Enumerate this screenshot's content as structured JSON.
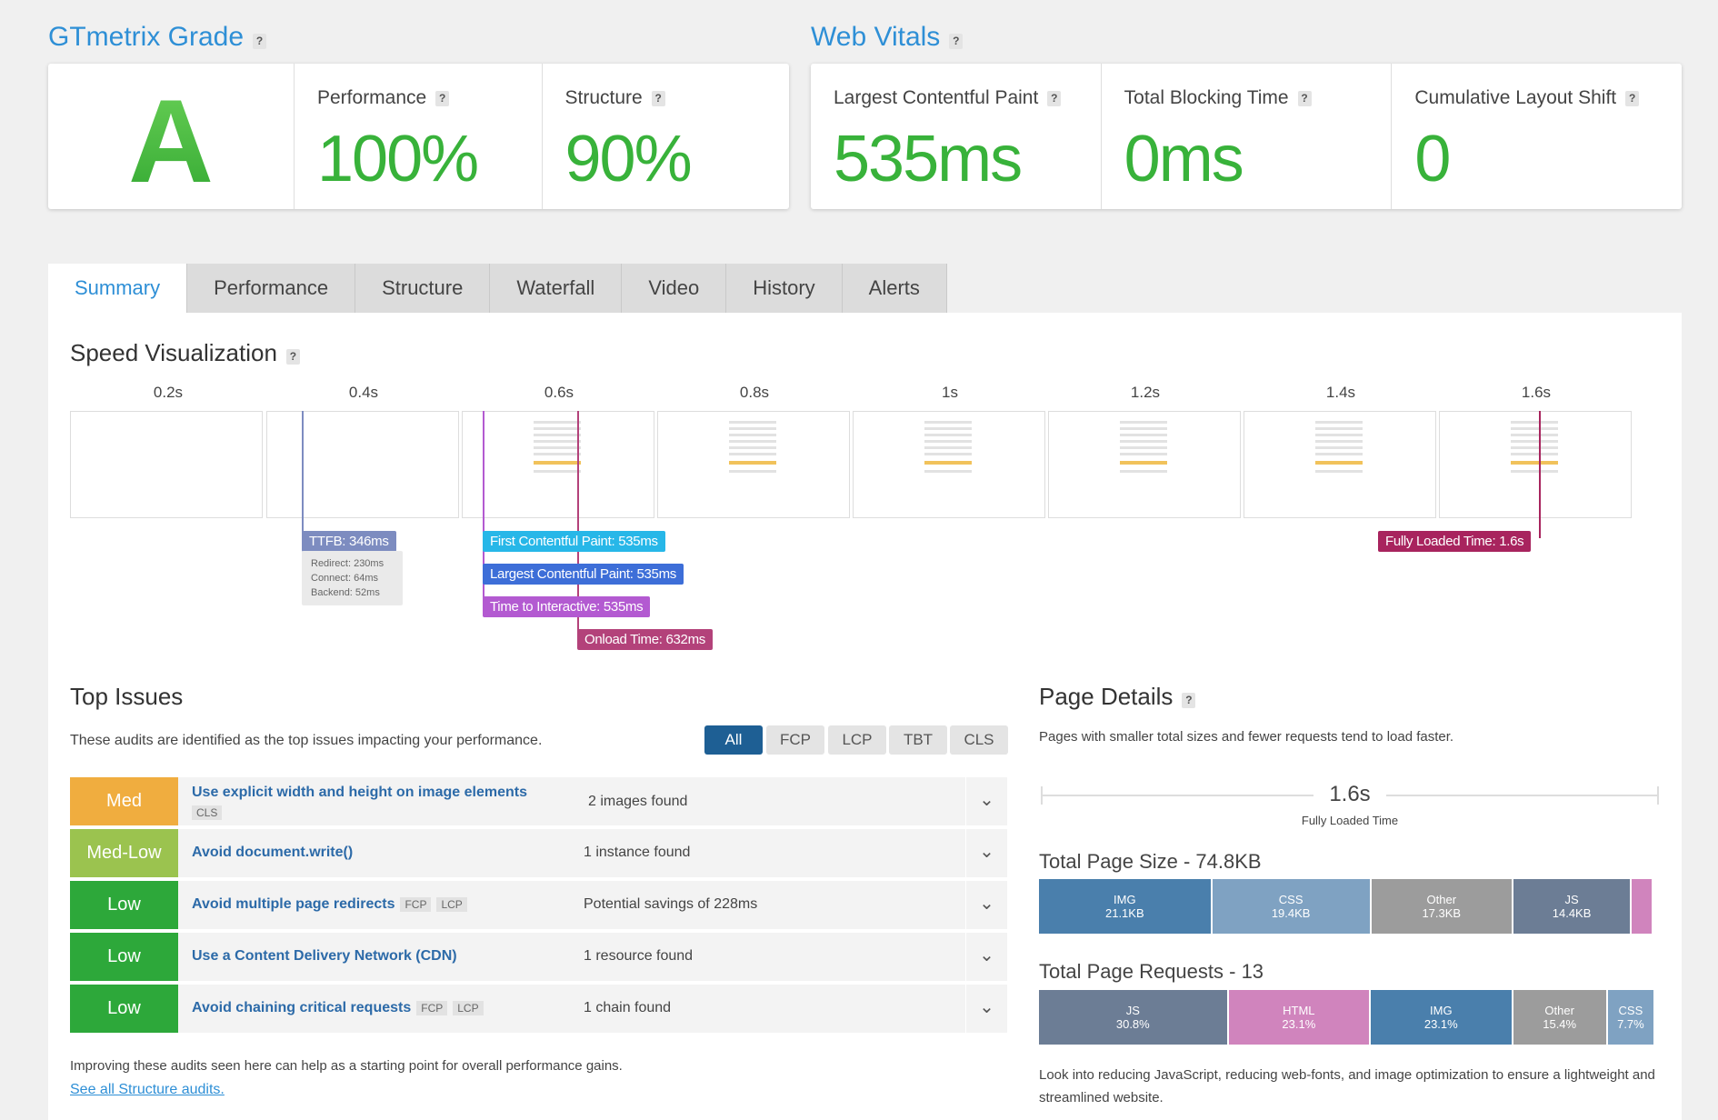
{
  "grade": {
    "title": "GTmetrix Grade",
    "letter": "A",
    "performance_label": "Performance",
    "performance_value": "100%",
    "structure_label": "Structure",
    "structure_value": "90%"
  },
  "vitals": {
    "title": "Web Vitals",
    "lcp_label": "Largest Contentful Paint",
    "lcp_value": "535ms",
    "tbt_label": "Total Blocking Time",
    "tbt_value": "0ms",
    "cls_label": "Cumulative Layout Shift",
    "cls_value": "0"
  },
  "help_glyph": "?",
  "tabs": [
    "Summary",
    "Performance",
    "Structure",
    "Waterfall",
    "Video",
    "History",
    "Alerts"
  ],
  "speed": {
    "title": "Speed Visualization",
    "ticks": [
      "0.2s",
      "0.4s",
      "0.6s",
      "0.8s",
      "1s",
      "1.2s",
      "1.4s",
      "1.6s"
    ],
    "ttfb": "TTFB: 346ms",
    "redirect": "Redirect: 230ms",
    "connect": "Connect: 64ms",
    "backend": "Backend: 52ms",
    "fcp": "First Contentful Paint: 535ms",
    "lcp": "Largest Contentful Paint: 535ms",
    "tti": "Time to Interactive: 535ms",
    "onload": "Onload Time: 632ms",
    "fully": "Fully Loaded Time: 1.6s",
    "colors": {
      "ttfb": "#7d8cc0",
      "fcp": "#27b7e8",
      "lcp": "#3d6ed8",
      "tti": "#b35ad1",
      "onload": "#b3427a",
      "fully": "#a8245e"
    }
  },
  "issues": {
    "title": "Top Issues",
    "desc": "These audits are identified as the top issues impacting your performance.",
    "filters": [
      "All",
      "FCP",
      "LCP",
      "TBT",
      "CLS"
    ],
    "items": [
      {
        "severity": "Med",
        "color": "#f0ad3f",
        "title": "Use explicit width and height on image elements",
        "tags": [
          "CLS"
        ],
        "finding": "2 images found"
      },
      {
        "severity": "Med-Low",
        "color": "#9bc34f",
        "title": "Avoid document.write()",
        "tags": [],
        "finding": "1 instance found"
      },
      {
        "severity": "Low",
        "color": "#2da83a",
        "title": "Avoid multiple page redirects",
        "tags": [
          "FCP",
          "LCP"
        ],
        "finding": "Potential savings of 228ms"
      },
      {
        "severity": "Low",
        "color": "#2da83a",
        "title": "Use a Content Delivery Network (CDN)",
        "tags": [],
        "finding": "1 resource found"
      },
      {
        "severity": "Low",
        "color": "#2da83a",
        "title": "Avoid chaining critical requests",
        "tags": [
          "FCP",
          "LCP"
        ],
        "finding": "1 chain found"
      }
    ],
    "footer": "Improving these audits seen here can help as a starting point for overall performance gains.",
    "link": "See all Structure audits."
  },
  "details": {
    "title": "Page Details",
    "desc": "Pages with smaller total sizes and fewer requests tend to load faster.",
    "fully_value": "1.6s",
    "fully_label": "Fully Loaded Time",
    "size_title": "Total Page Size - 74.8KB",
    "size_segments": [
      {
        "name": "IMG",
        "value": "21.1KB",
        "share": 28.2,
        "color": "#4a7fac"
      },
      {
        "name": "CSS",
        "value": "19.4KB",
        "share": 25.9,
        "color": "#7fa2c2"
      },
      {
        "name": "Other",
        "value": "17.3KB",
        "share": 23.1,
        "color": "#9c9c9c"
      },
      {
        "name": "JS",
        "value": "14.4KB",
        "share": 19.3,
        "color": "#6c7d95"
      },
      {
        "name": "",
        "value": "",
        "share": 3.5,
        "color": "#d084bd"
      }
    ],
    "req_title": "Total Page Requests - 13",
    "req_segments": [
      {
        "name": "JS",
        "value": "30.8%",
        "share": 30.8,
        "color": "#6c7d95"
      },
      {
        "name": "HTML",
        "value": "23.1%",
        "share": 23.1,
        "color": "#d084bd"
      },
      {
        "name": "IMG",
        "value": "23.1%",
        "share": 23.1,
        "color": "#4a7fac"
      },
      {
        "name": "Other",
        "value": "15.4%",
        "share": 15.4,
        "color": "#9c9c9c"
      },
      {
        "name": "CSS",
        "value": "7.7%",
        "share": 7.7,
        "color": "#7fa2c2"
      }
    ],
    "footer": "Look into reducing JavaScript, reducing web-fonts, and image optimization to ensure a lightweight and streamlined website."
  }
}
